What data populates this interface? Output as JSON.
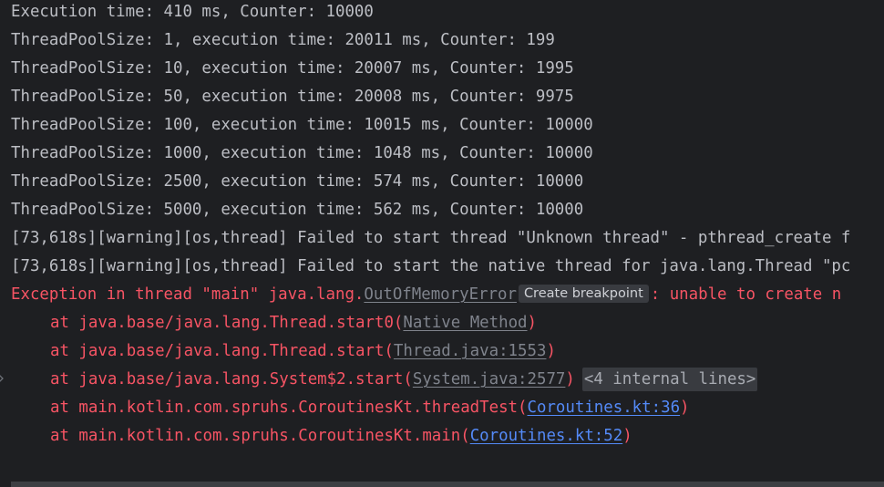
{
  "console": {
    "lines": [
      "Execution time: 410 ms, Counter: 10000",
      "ThreadPoolSize: 1, execution time: 20011 ms, Counter: 199",
      "ThreadPoolSize: 10, execution time: 20007 ms, Counter: 1995",
      "ThreadPoolSize: 50, execution time: 20008 ms, Counter: 9975",
      "ThreadPoolSize: 100, execution time: 10015 ms, Counter: 10000",
      "ThreadPoolSize: 1000, execution time: 1048 ms, Counter: 10000",
      "ThreadPoolSize: 2500, execution time: 574 ms, Counter: 10000",
      "ThreadPoolSize: 5000, execution time: 562 ms, Counter: 10000",
      "[73,618s][warning][os,thread] Failed to start thread \"Unknown thread\" - pthread_create f",
      "[73,618s][warning][os,thread] Failed to start the native thread for java.lang.Thread \"pc"
    ],
    "exception": {
      "prefix": "Exception in thread \"main\" java.lang.",
      "class_link": "OutOfMemoryError",
      "tooltip": "Create breakpoint",
      "suffix": ": unable to create n"
    },
    "stack": [
      {
        "prefix": "at java.base/java.lang.Thread.start0(",
        "link": "Native Method",
        "suffix": ")"
      },
      {
        "prefix": "at java.base/java.lang.Thread.start(",
        "link": "Thread.java:1553",
        "suffix": ")"
      },
      {
        "prefix": "at java.base/java.lang.System$2.start(",
        "link": "System.java:2577",
        "suffix": ")",
        "fold": "<4 internal lines>"
      },
      {
        "prefix": "at main.kotlin.com.spruhs.CoroutinesKt.threadTest(",
        "link": "Coroutines.kt:36",
        "suffix": ")"
      },
      {
        "prefix": "at main.kotlin.com.spruhs.CoroutinesKt.main(",
        "link": "Coroutines.kt:52",
        "suffix": ")"
      }
    ]
  },
  "colors": {
    "background": "#1e1f22",
    "stdout": "#bcbec4",
    "stderr": "#f75464",
    "link": "#548af7",
    "library_link": "#7f838c"
  },
  "icons": {
    "gutter": "chevron-right-icon"
  }
}
